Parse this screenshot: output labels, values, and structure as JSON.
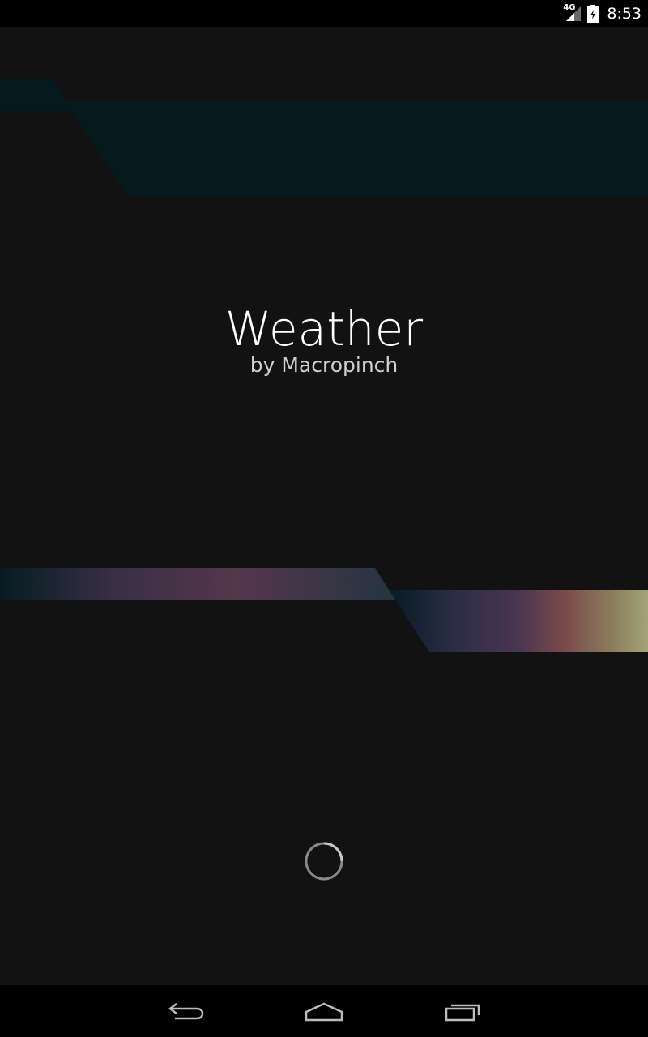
{
  "status_bar": {
    "network_type": "4G",
    "time": "8:53",
    "icons": [
      "signal-icon",
      "battery-icon"
    ]
  },
  "splash": {
    "title": "Weather",
    "subtitle": "by Macropinch"
  },
  "loading": {
    "icon": "spinner-icon"
  },
  "nav_bar": {
    "buttons": [
      "back-icon",
      "home-icon",
      "recent-apps-icon"
    ]
  },
  "colors": {
    "background": "#121213",
    "top_band": "#041a1f",
    "bottom_band_start": "#08222a",
    "bottom_band_mid": "#4a3a55",
    "bottom_band_end": "#9a9e6e"
  }
}
